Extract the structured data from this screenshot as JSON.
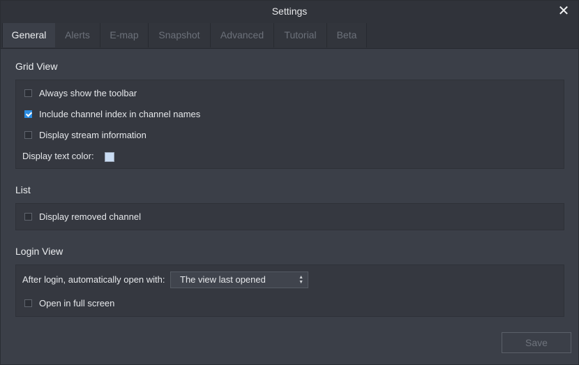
{
  "window": {
    "title": "Settings"
  },
  "tabs": [
    {
      "label": "General"
    },
    {
      "label": "Alerts"
    },
    {
      "label": "E-map"
    },
    {
      "label": "Snapshot"
    },
    {
      "label": "Advanced"
    },
    {
      "label": "Tutorial"
    },
    {
      "label": "Beta"
    }
  ],
  "grid_view": {
    "title": "Grid View",
    "items": [
      {
        "label": "Always show the toolbar",
        "checked": false
      },
      {
        "label": "Include channel index in channel names",
        "checked": true
      },
      {
        "label": "Display stream information",
        "checked": false
      }
    ],
    "text_color_label": "Display text color:",
    "text_color": "#c9dcf3"
  },
  "list": {
    "title": "List",
    "items": [
      {
        "label": "Display removed channel",
        "checked": false
      }
    ]
  },
  "login_view": {
    "title": "Login View",
    "open_with_label": "After login, automatically open with:",
    "open_with_value": "The view last opened",
    "full_screen_label": "Open in full screen",
    "full_screen_checked": false
  },
  "footer": {
    "save_label": "Save"
  },
  "colors": {
    "accent": "#2b8de3",
    "background": "#3b3f48",
    "titlebar": "#30333a"
  }
}
